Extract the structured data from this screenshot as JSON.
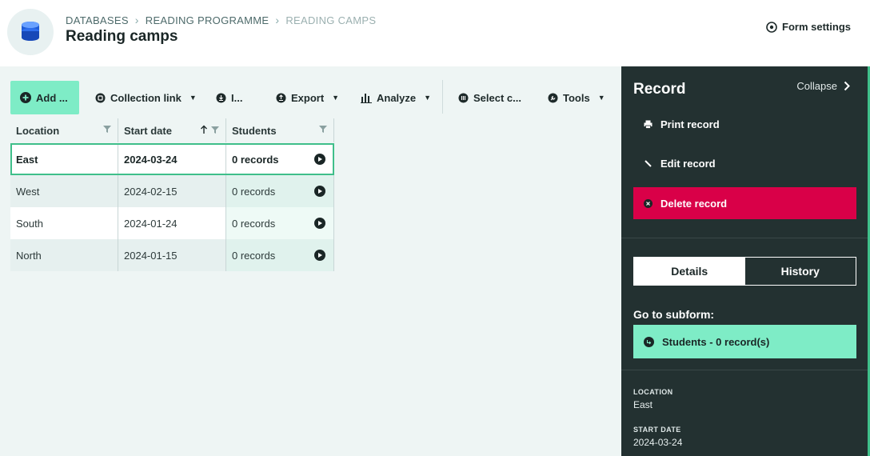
{
  "header": {
    "breadcrumb": [
      "DATABASES",
      "READING PROGRAMME",
      "READING CAMPS"
    ],
    "title": "Reading camps",
    "form_settings": "Form settings"
  },
  "toolbar": {
    "add": "Add ...",
    "collection_link": "Collection link",
    "import": "I...",
    "export": "Export",
    "analyze": "Analyze",
    "select_columns": "Select c...",
    "tools": "Tools"
  },
  "table": {
    "columns": [
      "Location",
      "Start date",
      "Students"
    ],
    "rows": [
      {
        "location": "East",
        "start_date": "2024-03-24",
        "students": "0 records"
      },
      {
        "location": "West",
        "start_date": "2024-02-15",
        "students": "0 records"
      },
      {
        "location": "South",
        "start_date": "2024-01-24",
        "students": "0 records"
      },
      {
        "location": "North",
        "start_date": "2024-01-15",
        "students": "0 records"
      }
    ]
  },
  "panel": {
    "title": "Record",
    "collapse": "Collapse",
    "print": "Print record",
    "edit": "Edit record",
    "delete": "Delete record",
    "tabs": [
      "Details",
      "History"
    ],
    "subform_heading": "Go to subform:",
    "subform_button": "Students - 0 record(s)",
    "fields": [
      {
        "label": "LOCATION",
        "value": "East"
      },
      {
        "label": "START DATE",
        "value": "2024-03-24"
      }
    ]
  },
  "colors": {
    "accent_green": "#7eecc6",
    "panel_bg": "#233131",
    "delete_red": "#d90048",
    "page_bg": "#eef5f4"
  }
}
